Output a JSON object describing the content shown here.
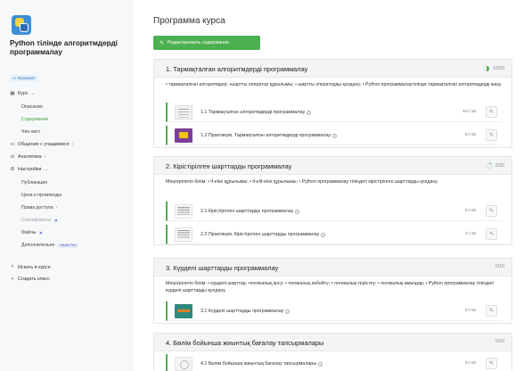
{
  "sidebar": {
    "course_title": "Python тілінде алгоритмдерді программалау",
    "status_badge": "✏ Жазылый",
    "items": {
      "course": {
        "label": "Курс",
        "icon": "grid-icon"
      },
      "description": {
        "label": "Описание"
      },
      "contents": {
        "label": "Содержание"
      },
      "checklist": {
        "label": "Чек-лист"
      },
      "students": {
        "label": "Общение с учащимися",
        "icon": "chat-icon"
      },
      "analytics": {
        "label": "Аналитика",
        "icon": "bar-chart-icon"
      },
      "settings": {
        "label": "Настройки",
        "icon": "gear-icon"
      },
      "publication": {
        "label": "Публикация"
      },
      "prices": {
        "label": "Цена и промокоды"
      },
      "access": {
        "label": "Права доступа"
      },
      "certificates": {
        "label": "Сертификаты"
      },
      "files": {
        "label": "Файлы"
      },
      "additional": {
        "label": "Дополнительно",
        "pill": "Stepik Plus"
      },
      "search": {
        "label": "Искать в курсе",
        "icon": "search-icon"
      },
      "create_class": {
        "label": "Создать класс",
        "icon": "plus-icon"
      }
    }
  },
  "main": {
    "title": "Программа курса",
    "edit_button": "Редактировать содержание",
    "sections": [
      {
        "title": "1. Тармақталған алгоритмдерді программалау",
        "progress": "10/20",
        "progress_fraction": 0.5,
        "description": "• тармақталған алгоритмдер; •шартты оператор құрылымы; • шартты операторды қолдану; • Python программалаутілінде тармақталған алгоритмдерді жазу.",
        "lessons": [
          {
            "title": "1.1 Тармақталған алгоритмдерді программалау",
            "score": "10 / 10",
            "thumb": "doc"
          },
          {
            "title": "1.2 Практикум. Тармақталған алгоритмдерді программалау",
            "score": "0 / 10",
            "thumb": "purple"
          }
        ]
      },
      {
        "title": "2. Кірістірілген шарттарды программалау",
        "progress": "2/20",
        "progress_fraction": 0.1,
        "description": "Меңгерілетін білім: • if-else құрылымы; • if-elif-else құрылымы; • Python программалау тіліндегі кірістірілген шарттарды қолдану.",
        "lessons": [
          {
            "title": "2.1 Кірістірілген шарттарды программалау",
            "score": "0 / 10",
            "thumb": "code"
          },
          {
            "title": "2.2 Практикум. Кірістірілген шарттарды программалау",
            "score": "2 / 10",
            "thumb": "code"
          }
        ]
      },
      {
        "title": "3. Күрделі шарттарды программалау",
        "progress": "0/10",
        "description": "Меңгерілетін білім: • күрделі шарттар; •логикалық қосу; • логикалық көбейту; • логикалық терістеу; • логикалық амалдар; • Python программалау тіліндегі күрделі шарттарды қолдану.",
        "lessons": [
          {
            "title": "3.1 Күрделі шарттарды программалау",
            "score": "0 / 10",
            "thumb": "teal"
          }
        ]
      },
      {
        "title": "4. Бөлім бойынша жиынтық бағалау тапсырмалары",
        "progress": "0/10",
        "lessons": [
          {
            "title": "4.1 Бөлім бойынша жиынтық бағалау тапсырмалары",
            "score": "0 / 10",
            "thumb": "ghost"
          }
        ]
      }
    ]
  },
  "colors": {
    "accent": "#4caf50",
    "link_blue": "#2e7bc4",
    "section_header_bg": "#f3f4f5"
  }
}
